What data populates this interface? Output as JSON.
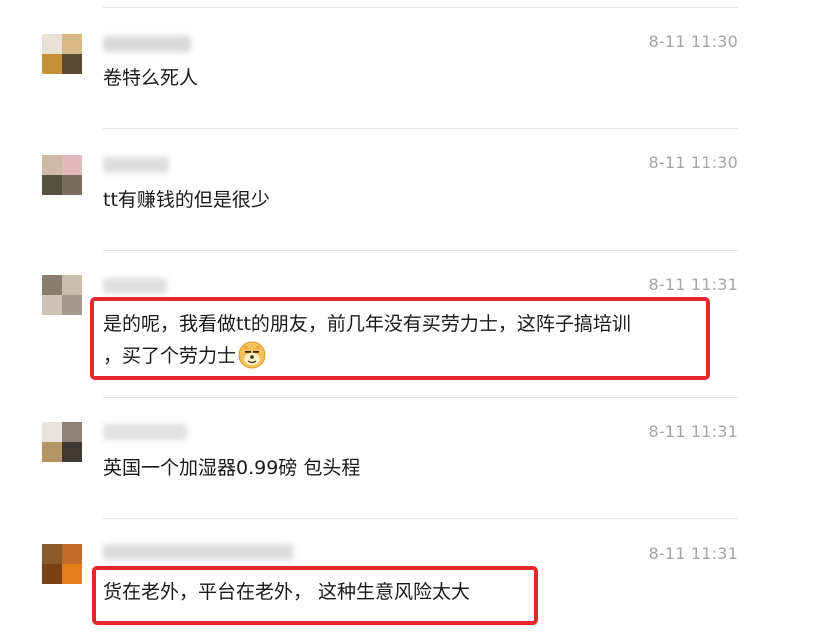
{
  "comments": [
    {
      "time": "8-11 11:30",
      "text": "卷特么死人"
    },
    {
      "time": "8-11 11:30",
      "text": "tt有赚钱的但是很少"
    },
    {
      "time": "8-11 11:31",
      "text_line1": "是的呢，我看做tt的朋友，前几年没有买劳力士，这阵子搞培训",
      "text_line2": "，买了个劳力士"
    },
    {
      "time": "8-11 11:31",
      "text": "英国一个加湿器0.99磅 包头程"
    },
    {
      "time": "8-11 11:31",
      "text": "货在老外，平台在老外， 这种生意风险太大"
    }
  ],
  "icons": {
    "emoji": "doge-face-icon"
  },
  "colors": {
    "highlight": "#e5262d",
    "time": "#a5a5a5",
    "divider": "#e3e3e3",
    "text": "#191919"
  }
}
